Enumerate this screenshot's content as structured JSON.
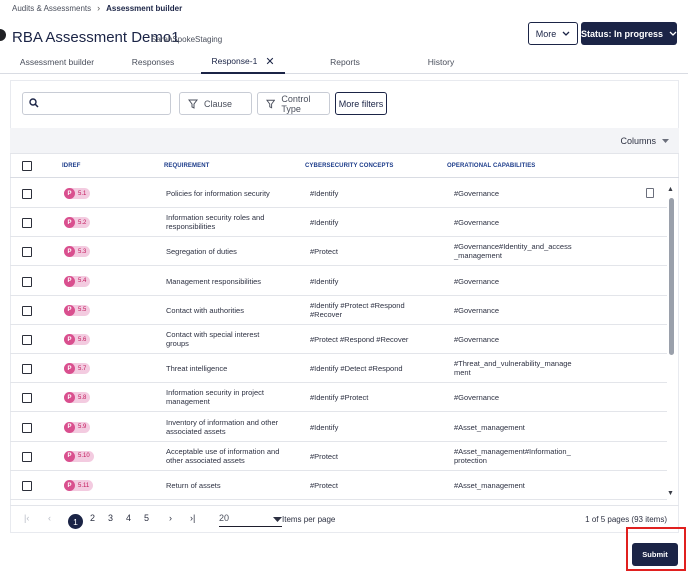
{
  "breadcrumb": {
    "parent": "Audits & Assessments",
    "current": "Assessment builder"
  },
  "header": {
    "title": "RBA Assessment Demo1",
    "subtitle": "SarahSpokeStaging",
    "more_label": "More",
    "status_label": "Status: In progress"
  },
  "tabs": [
    {
      "label": "Assessment builder"
    },
    {
      "label": "Responses"
    },
    {
      "label": "Response-1"
    },
    {
      "label": "Reports"
    },
    {
      "label": "History"
    }
  ],
  "filters": {
    "search_placeholder": "",
    "clause_label": "Clause",
    "control_type_label": "Control Type",
    "more_filters_label": "More filters"
  },
  "grid": {
    "columns_label": "Columns",
    "headers": {
      "idref": "IDREF",
      "requirement": "REQUIREMENT",
      "concepts": "CYBERSECURITY CONCEPTS",
      "capabilities": "OPERATIONAL CAPABILITIES"
    },
    "rows": [
      {
        "badge": "P",
        "id": "5.1",
        "requirement": [
          "Policies for information security"
        ],
        "concepts": [
          "#Identify"
        ],
        "capabilities": [
          "#Governance"
        ]
      },
      {
        "badge": "P",
        "id": "5.2",
        "requirement": [
          "Information security roles and",
          "responsibilities"
        ],
        "concepts": [
          "#Identify"
        ],
        "capabilities": [
          "#Governance"
        ]
      },
      {
        "badge": "P",
        "id": "5.3",
        "requirement": [
          "Segregation of duties"
        ],
        "concepts": [
          "#Protect"
        ],
        "capabilities": [
          "#Governance#Identity_and_access",
          "_management"
        ]
      },
      {
        "badge": "P",
        "id": "5.4",
        "requirement": [
          "Management responsibilities"
        ],
        "concepts": [
          "#Identify"
        ],
        "capabilities": [
          "#Governance"
        ]
      },
      {
        "badge": "P",
        "id": "5.5",
        "requirement": [
          "Contact with authorities"
        ],
        "concepts": [
          "#Identify #Protect #Respond",
          "#Recover"
        ],
        "capabilities": [
          "#Governance"
        ]
      },
      {
        "badge": "P",
        "id": "5.6",
        "requirement": [
          "Contact with special interest",
          "groups"
        ],
        "concepts": [
          "#Protect #Respond #Recover"
        ],
        "capabilities": [
          "#Governance"
        ]
      },
      {
        "badge": "P",
        "id": "5.7",
        "requirement": [
          "Threat intelligence"
        ],
        "concepts": [
          "#Identify #Detect #Respond"
        ],
        "capabilities": [
          "#Threat_and_vulnerability_manage",
          "ment"
        ]
      },
      {
        "badge": "P",
        "id": "5.8",
        "requirement": [
          "Information security in project",
          "management"
        ],
        "concepts": [
          "#Identify #Protect"
        ],
        "capabilities": [
          "#Governance"
        ]
      },
      {
        "badge": "P",
        "id": "5.9",
        "requirement": [
          "Inventory of information and other",
          "associated assets"
        ],
        "concepts": [
          "#Identify"
        ],
        "capabilities": [
          "#Asset_management"
        ]
      },
      {
        "badge": "P",
        "id": "5.10",
        "requirement": [
          "Acceptable use of information and",
          "other associated assets"
        ],
        "concepts": [
          "#Protect"
        ],
        "capabilities": [
          "#Asset_management#Information_",
          "protection"
        ]
      },
      {
        "badge": "P",
        "id": "5.11",
        "requirement": [
          "Return of assets"
        ],
        "concepts": [
          "#Protect"
        ],
        "capabilities": [
          "#Asset_management"
        ]
      }
    ]
  },
  "pagination": {
    "pages": [
      "1",
      "2",
      "3",
      "4",
      "5"
    ],
    "current_page": "1",
    "per_page_value": "20",
    "per_page_label": "Items per page",
    "info": "1 of 5 pages (93 items)",
    "icons": {
      "first": "first-page-icon",
      "prev": "prev-page-icon",
      "next": "next-page-icon",
      "last": "last-page-icon"
    }
  },
  "footer": {
    "submit_label": "Submit"
  },
  "colors": {
    "primary": "#1b2446",
    "badge_bg": "#f3cbe0",
    "badge_dot": "#d94f8e",
    "highlight": "#e0201f"
  }
}
